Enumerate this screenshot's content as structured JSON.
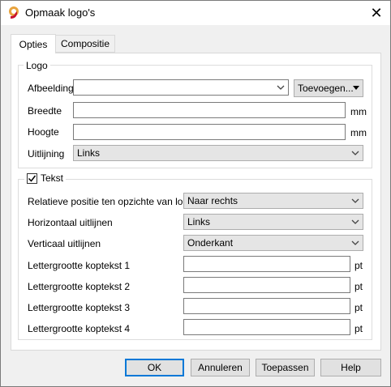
{
  "window": {
    "title": "Opmaak logo's",
    "close_glyph": "✕"
  },
  "tabs": [
    {
      "label": "Opties",
      "active": true
    },
    {
      "label": "Compositie",
      "active": false
    }
  ],
  "logo_group": {
    "title": "Logo",
    "image_label": "Afbeelding",
    "image_value": "",
    "add_button": "Toevoegen...",
    "width_label": "Breedte",
    "width_value": "",
    "width_unit": "mm",
    "height_label": "Hoogte",
    "height_value": "",
    "height_unit": "mm",
    "align_label": "Uitlijning",
    "align_value": "Links"
  },
  "text_group": {
    "title": "Tekst",
    "checked": true,
    "relpos_label": "Relatieve positie ten opzichte van logo",
    "relpos_value": "Naar rechts",
    "halign_label": "Horizontaal uitlijnen",
    "halign_value": "Links",
    "valign_label": "Verticaal uitlijnen",
    "valign_value": "Onderkant",
    "fs1_label": "Lettergrootte koptekst 1",
    "fs2_label": "Lettergrootte koptekst 2",
    "fs3_label": "Lettergrootte koptekst 3",
    "fs4_label": "Lettergrootte koptekst 4",
    "fs_unit": "pt",
    "fs1_value": "",
    "fs2_value": "",
    "fs3_value": "",
    "fs4_value": ""
  },
  "buttons": {
    "ok": "OK",
    "cancel": "Annuleren",
    "apply": "Toepassen",
    "help": "Help"
  },
  "colors": {
    "accent": "#0078d7",
    "logo_orange": "#e8a33d",
    "logo_red": "#c8102e"
  }
}
